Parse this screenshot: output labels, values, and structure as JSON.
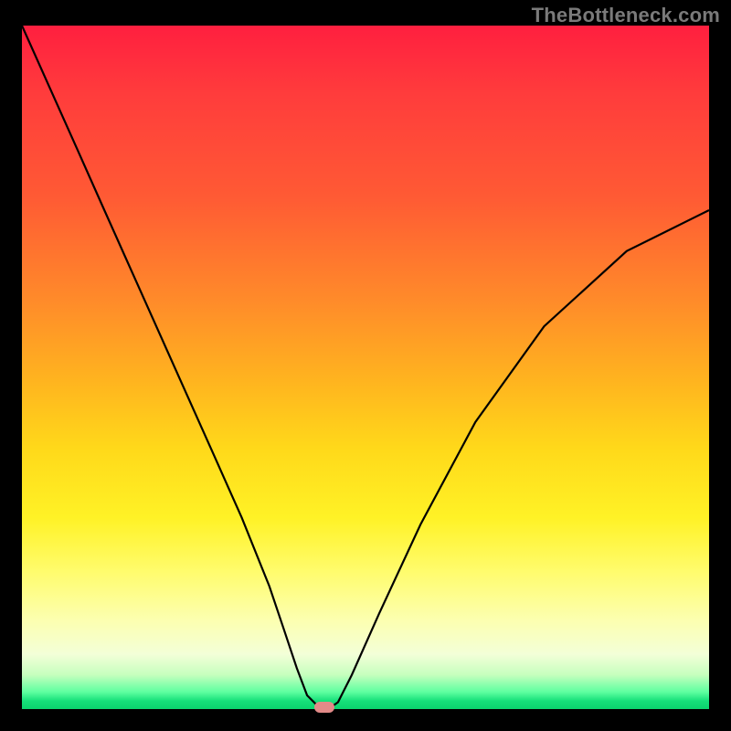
{
  "watermark": "TheBottleneck.com",
  "colors": {
    "curve_stroke": "#000000",
    "marker_fill": "#e28a88",
    "frame_bg": "#000000"
  },
  "chart_data": {
    "type": "line",
    "title": "",
    "xlabel": "",
    "ylabel": "",
    "xlim": [
      0,
      100
    ],
    "ylim": [
      0,
      100
    ],
    "series": [
      {
        "name": "bottleneck-curve",
        "x": [
          0,
          4,
          8,
          12,
          16,
          20,
          24,
          28,
          32,
          36,
          38,
          40,
          41.5,
          43,
          44,
          45,
          46,
          48,
          52,
          58,
          66,
          76,
          88,
          100
        ],
        "y": [
          100,
          91,
          82,
          73,
          64,
          55,
          46,
          37,
          28,
          18,
          12,
          6,
          2,
          0.5,
          0.3,
          0.3,
          1,
          5,
          14,
          27,
          42,
          56,
          67,
          73
        ]
      }
    ],
    "annotations": [
      {
        "name": "optimal-marker",
        "x": 44,
        "y": 0.3
      }
    ],
    "grid": false,
    "legend": false
  }
}
